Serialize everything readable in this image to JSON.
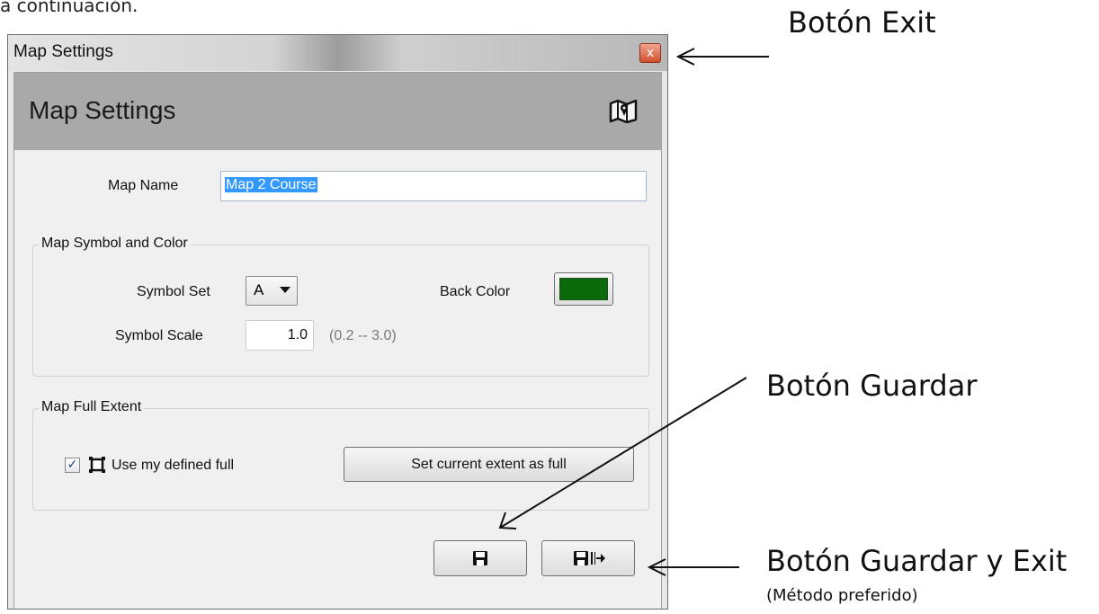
{
  "doc_text": "a continuación.",
  "window": {
    "title": "Map Settings",
    "close_glyph": "x"
  },
  "header": {
    "title": "Map Settings",
    "icon": "map-icon"
  },
  "map_name": {
    "label": "Map Name",
    "value": "Map 2 Course"
  },
  "symbol_group": {
    "title": "Map Symbol and Color",
    "symbol_set_label": "Symbol Set",
    "symbol_set_value": "A",
    "back_color_label": "Back Color",
    "back_color": "#0b6b0b",
    "symbol_scale_label": "Symbol Scale",
    "symbol_scale_value": "1.0",
    "symbol_scale_range": "(0.2 -- 3.0)"
  },
  "extent_group": {
    "title": "Map Full Extent",
    "checkbox_checked": true,
    "checkbox_label": "Use my defined full",
    "set_button_label": "Set current extent as full"
  },
  "buttons": {
    "save_icon": "save-icon",
    "save_exit_icon": "save-exit-icon"
  },
  "annotations": {
    "exit": "Botón Exit",
    "save": "Botón Guardar",
    "save_exit": "Botón Guardar y Exit",
    "save_exit_note": "(Método preferido)"
  }
}
